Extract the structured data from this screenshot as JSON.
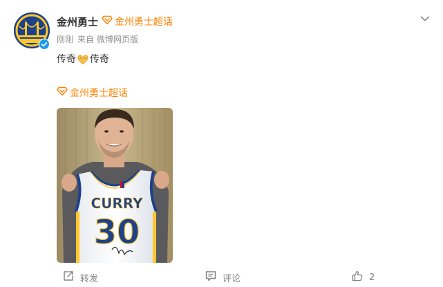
{
  "post": {
    "author_name": "金州勇士",
    "author_super_topic": "金州勇士超话",
    "time": "刚刚",
    "source": "来自 微博网页版",
    "text_part1": "传奇",
    "text_part2": "传奇",
    "emoji_name": "heart-hands-emoji",
    "topic_tag": "金州勇士超话",
    "jersey_name": "CURRY",
    "jersey_number": "30"
  },
  "actions": {
    "repost_label": "转发",
    "comment_label": "评论",
    "like_count": "2"
  },
  "icons": {
    "more": "chevron-down-icon",
    "verified": "verified-badge-icon",
    "super_topic": "diamond-icon",
    "repost": "share-icon",
    "comment": "comment-icon",
    "like": "thumbs-up-icon"
  },
  "colors": {
    "accent_orange": "#ff8200",
    "verified_blue": "#1e9bf0",
    "text_gray": "#939393"
  }
}
